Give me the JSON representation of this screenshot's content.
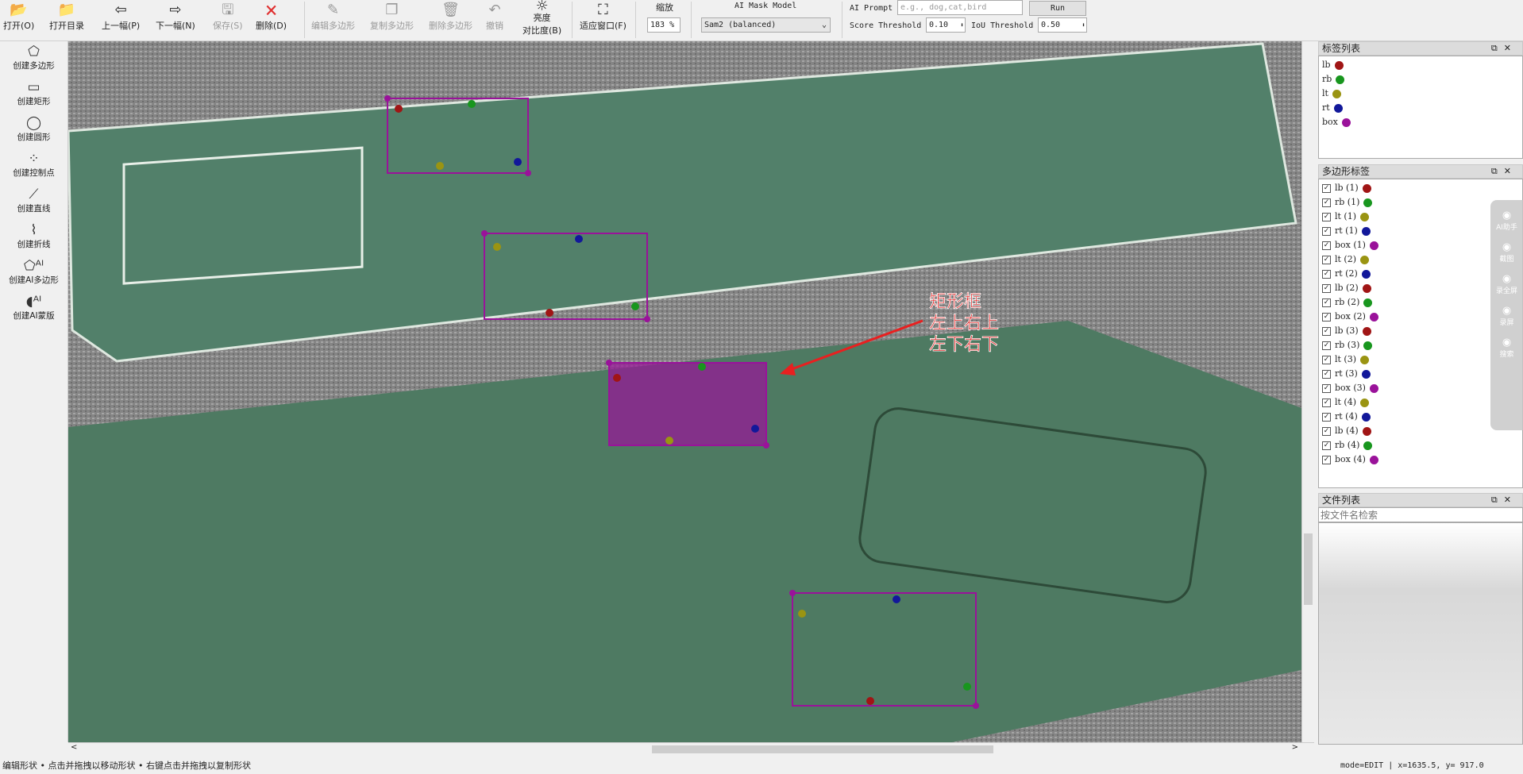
{
  "toolbar": {
    "items": [
      {
        "label": "打开(O)",
        "icon": "folder-open-icon",
        "enabled": true
      },
      {
        "label": "打开目录",
        "icon": "folder-icon",
        "enabled": true
      },
      {
        "label": "上一幅(P)",
        "icon": "arrow-left-icon",
        "enabled": true
      },
      {
        "label": "下一幅(N)",
        "icon": "arrow-right-icon",
        "enabled": true
      },
      {
        "label": "保存(S)",
        "icon": "save-icon",
        "enabled": false
      },
      {
        "label": "删除(D)",
        "icon": "delete-file-icon",
        "enabled": true
      },
      {
        "label": "编辑多边形",
        "icon": "edit-icon",
        "enabled": false
      },
      {
        "label": "复制多边形",
        "icon": "copy-icon",
        "enabled": false
      },
      {
        "label": "删除多边形",
        "icon": "trash-icon",
        "enabled": false
      },
      {
        "label": "撤销",
        "icon": "undo-icon",
        "enabled": false
      },
      {
        "label": "亮度",
        "label2": "对比度(B)",
        "icon": "brightness-icon",
        "enabled": true
      },
      {
        "label": "适应窗口(F)",
        "icon": "fit-window-icon",
        "enabled": true
      }
    ],
    "zoom_label": "缩放",
    "zoom_value": "183 %",
    "model_label": "AI Mask Model",
    "model_value": "Sam2 (balanced)",
    "prompt_label": "AI Prompt",
    "prompt_placeholder": "e.g., dog,cat,bird",
    "run_label": "Run",
    "score_label": "Score Threshold",
    "score_value": "0.10",
    "iou_label": "IoU Threshold",
    "iou_value": "0.50"
  },
  "left_tools": [
    {
      "label": "创建多边形",
      "icon": "polygon-icon"
    },
    {
      "label": "创建矩形",
      "icon": "rectangle-icon"
    },
    {
      "label": "创建圆形",
      "icon": "circle-icon"
    },
    {
      "label": "创建控制点",
      "icon": "points-icon"
    },
    {
      "label": "创建直线",
      "icon": "line-icon"
    },
    {
      "label": "创建折线",
      "icon": "polyline-icon"
    },
    {
      "label": "创建AI多边形",
      "icon": "ai-polygon-icon"
    },
    {
      "label": "创建AI蒙版",
      "icon": "ai-mask-icon"
    }
  ],
  "colors": {
    "lb": "#a01515",
    "rb": "#18961e",
    "lt": "#9a9412",
    "rt": "#12189a",
    "box": "#9a129a"
  },
  "label_list": {
    "title": "标签列表",
    "items": [
      "lb",
      "rb",
      "lt",
      "rt",
      "box"
    ]
  },
  "polygon_labels": {
    "title": "多边形标签",
    "items": [
      {
        "label": "lb (1)",
        "cls": "lb"
      },
      {
        "label": "rb (1)",
        "cls": "rb"
      },
      {
        "label": "lt (1)",
        "cls": "lt"
      },
      {
        "label": "rt (1)",
        "cls": "rt"
      },
      {
        "label": "box (1)",
        "cls": "box"
      },
      {
        "label": "lt (2)",
        "cls": "lt"
      },
      {
        "label": "rt (2)",
        "cls": "rt"
      },
      {
        "label": "lb (2)",
        "cls": "lb"
      },
      {
        "label": "rb (2)",
        "cls": "rb"
      },
      {
        "label": "box (2)",
        "cls": "box"
      },
      {
        "label": "lb (3)",
        "cls": "lb"
      },
      {
        "label": "rb (3)",
        "cls": "rb"
      },
      {
        "label": "lt (3)",
        "cls": "lt"
      },
      {
        "label": "rt (3)",
        "cls": "rt"
      },
      {
        "label": "box (3)",
        "cls": "box"
      },
      {
        "label": "lt (4)",
        "cls": "lt"
      },
      {
        "label": "rt (4)",
        "cls": "rt"
      },
      {
        "label": "lb (4)",
        "cls": "lb"
      },
      {
        "label": "rb (4)",
        "cls": "rb"
      },
      {
        "label": "box (4)",
        "cls": "box"
      }
    ]
  },
  "file_list": {
    "title": "文件列表",
    "search_placeholder": "按文件名检索"
  },
  "annotation": {
    "lines": [
      "矩形框",
      "左上右上",
      "左下右下"
    ]
  },
  "float_bar": {
    "items": [
      "AI助手",
      "截图",
      "录全屏",
      "录屏",
      "搜索"
    ]
  },
  "status": {
    "message": "编辑形状 • 点击并拖拽以移动形状 • 右键点击并拖拽以复制形状",
    "mode": "mode=EDIT | x=1635.5, y= 917.0"
  }
}
